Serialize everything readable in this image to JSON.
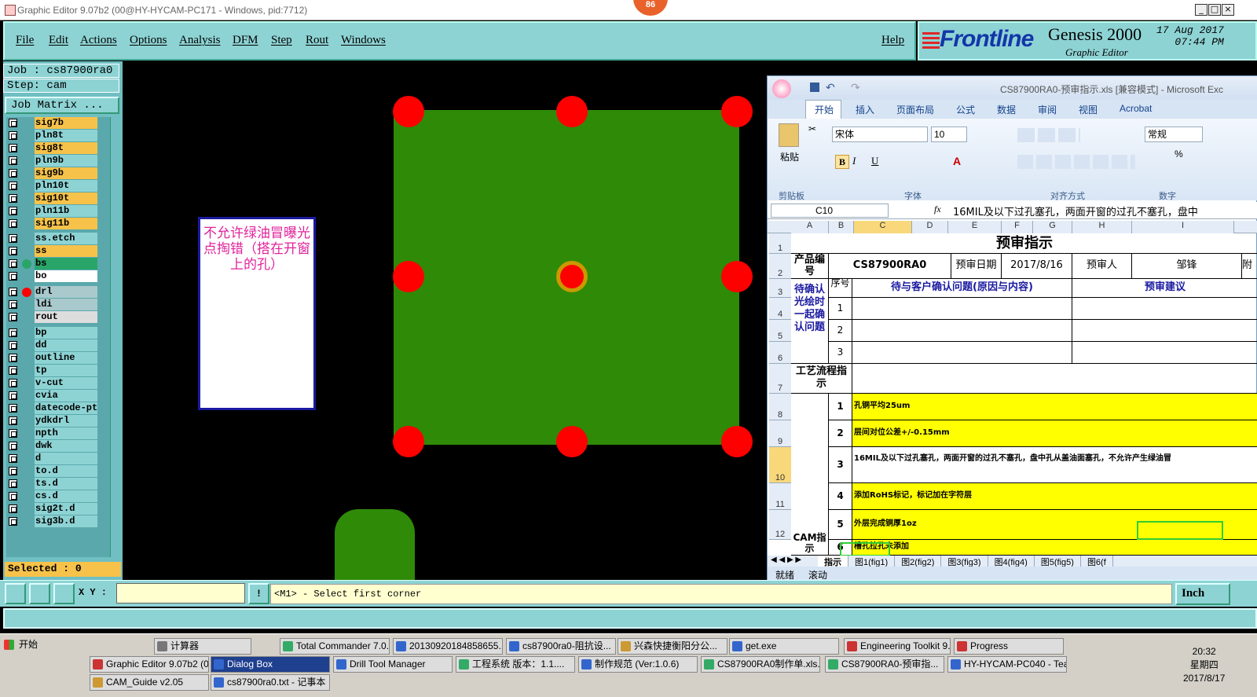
{
  "window": {
    "title": "Graphic Editor 9.07b2 (00@HY-HYCAM-PC171 - Windows, pid:7712)",
    "badge": "86",
    "controls": [
      "_",
      "□",
      "×"
    ]
  },
  "menubar": {
    "items": [
      "File",
      "Edit",
      "Actions",
      "Options",
      "Analysis",
      "DFM",
      "Step",
      "Rout",
      "Windows"
    ],
    "help": "Help"
  },
  "brand": {
    "logo": "Frontline",
    "product": "Genesis 2000",
    "subtitle": "Graphic Editor",
    "date": "17 Aug 2017",
    "time": "07:44 PM"
  },
  "job": {
    "job_line": "Job : cs87900ra0",
    "step_line": "Step: cam",
    "job_matrix": "Job Matrix ..."
  },
  "layers": [
    {
      "name": "sig7b",
      "color": "#f7c24a"
    },
    {
      "name": "pln8t",
      "color": "#8ed3d4"
    },
    {
      "name": "sig8t",
      "color": "#f7c24a"
    },
    {
      "name": "pln9b",
      "color": "#8ed3d4"
    },
    {
      "name": "sig9b",
      "color": "#f7c24a"
    },
    {
      "name": "pln10t",
      "color": "#8ed3d4"
    },
    {
      "name": "sig10t",
      "color": "#f7c24a"
    },
    {
      "name": "pln11b",
      "color": "#8ed3d4"
    },
    {
      "name": "sig11b",
      "color": "#f7c24a"
    },
    {
      "name": "ss.etch",
      "color": "#8ed3d4"
    },
    {
      "name": "ss",
      "color": "#f7c24a"
    },
    {
      "name": "bs",
      "color": "#2aa56a",
      "dot": "#2aa56a"
    },
    {
      "name": "bo",
      "color": "#ffffff"
    },
    {
      "name": "drl",
      "color": "#a9c9cc",
      "dot": "#ff0000"
    },
    {
      "name": "ldi",
      "color": "#a9c9cc"
    },
    {
      "name": "rout",
      "color": "#dddddd"
    },
    {
      "name": "bp",
      "color": "#8ed3d4"
    },
    {
      "name": "dd",
      "color": "#8ed3d4"
    },
    {
      "name": "outline",
      "color": "#8ed3d4"
    },
    {
      "name": "tp",
      "color": "#8ed3d4"
    },
    {
      "name": "v-cut",
      "color": "#8ed3d4"
    },
    {
      "name": "cvia",
      "color": "#8ed3d4"
    },
    {
      "name": "datecode-pte",
      "color": "#8ed3d4"
    },
    {
      "name": "ydkdrl",
      "color": "#8ed3d4"
    },
    {
      "name": "npth",
      "color": "#8ed3d4"
    },
    {
      "name": "dwk",
      "color": "#8ed3d4"
    },
    {
      "name": "d",
      "color": "#8ed3d4"
    },
    {
      "name": "to.d",
      "color": "#8ed3d4"
    },
    {
      "name": "ts.d",
      "color": "#8ed3d4"
    },
    {
      "name": "cs.d",
      "color": "#8ed3d4"
    },
    {
      "name": "sig2t.d",
      "color": "#8ed3d4"
    },
    {
      "name": "sig3b.d",
      "color": "#8ed3d4"
    }
  ],
  "selected": "Selected : 0",
  "canvas": {
    "note": "不允许绿油冒曝光点掏错（搭在开窗上的孔）",
    "board_color": "#2f8a07",
    "pad_color": "#ff0000"
  },
  "excel": {
    "title": "CS87900RA0-预审指示.xls  [兼容模式] - Microsoft Exc",
    "tabs": [
      "开始",
      "插入",
      "页面布局",
      "公式",
      "数据",
      "审阅",
      "视图",
      "Acrobat"
    ],
    "font_name": "宋体",
    "font_size": "10",
    "number_format": "常规",
    "groups": [
      "剪贴板",
      "字体",
      "对齐方式",
      "数字"
    ],
    "paste": "粘贴",
    "cell_ref": "C10",
    "fx": "fx",
    "formula": "16MIL及以下过孔塞孔，两面开窗的过孔不塞孔，盘中",
    "columns": [
      "A",
      "B",
      "C",
      "D",
      "E",
      "F",
      "G",
      "H",
      "I"
    ],
    "rows": [
      "1",
      "2",
      "3",
      "4",
      "5",
      "6",
      "7",
      "8",
      "9",
      "10",
      "11",
      "12"
    ],
    "sheet_title": "预审指示",
    "product_label": "产品编号",
    "product_code": "CS87900RA0",
    "review_date_label": "预审日期",
    "review_date": "2017/8/16",
    "reviewer_label": "预审人",
    "reviewer": "邹锋",
    "extra_col": "附",
    "confirm_label": "待确认光绘时一起确认问题",
    "seq_label": "序号",
    "issue_header": "待与客户确认问题(原因与内容)",
    "advice_header": "预审建议",
    "confirm_seq": [
      "1",
      "2",
      "3"
    ],
    "process_label": "工艺流程指示",
    "cam_label": "CAM指示",
    "instructions": [
      {
        "n": "1",
        "text": "孔铜平均25um"
      },
      {
        "n": "2",
        "text": "层间对位公差+/-0.15mm"
      },
      {
        "n": "3",
        "text": "16MIL及以下过孔塞孔，两面开窗的过孔不塞孔，盘中孔从盖油面塞孔，不允许产生绿油冒"
      },
      {
        "n": "4",
        "text": "添加RoHS标记，标记加在字符层"
      },
      {
        "n": "5",
        "text": "外层完成铜厚1oz"
      },
      {
        "n": "6",
        "text": "槽孔拉孔未添加"
      }
    ],
    "sheets": [
      "指示",
      "图1(fig1)",
      "图2(fig2)",
      "图3(fig3)",
      "图4(fig4)",
      "图5(fig5)",
      "图6(f"
    ],
    "status": [
      "就绪",
      "滚动"
    ]
  },
  "command": {
    "xy_label": "X Y :",
    "xy_value": "",
    "prompt": "<M1> - Select first corner",
    "units": "Inch"
  },
  "taskbar": {
    "start": "开始",
    "row1": [
      "计算器",
      "Total Commander 7.0...",
      "20130920184858655...",
      "cs87900ra0-阻抗设...",
      "兴森快捷衡阳分公...",
      "get.exe",
      "Engineering Toolkit 9....",
      "Progress"
    ],
    "row2": [
      "Graphic Editor 9.07b2 (0...",
      "Dialog Box",
      "Drill Tool Manager",
      "工程系统  版本：1.1....",
      "制作规范 (Ver:1.0.6)",
      "CS87900RA0制作单.xls...",
      "CS87900RA0-预审指...",
      "HY-HYCAM-PC040 - Tea..."
    ],
    "row3": [
      "CAM_Guide v2.05",
      "cs87900ra0.txt - 记事本"
    ],
    "clock_time": "20:32",
    "clock_day": "星期四",
    "clock_date": "2017/8/17"
  }
}
